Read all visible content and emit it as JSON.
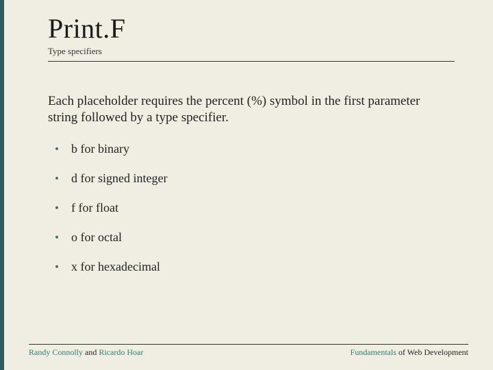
{
  "header": {
    "title": "Print.F",
    "subtitle": "Type specifiers"
  },
  "body": {
    "lead": "Each placeholder requires the percent (%) symbol in the first parameter string followed by a type specifier.",
    "items": [
      "b for binary",
      "d for signed integer",
      "f for float",
      "o for octal",
      "x for hexadecimal"
    ]
  },
  "footer": {
    "left_a": "Randy Connolly",
    "left_mid": " and ",
    "left_b": "Ricardo Hoar",
    "right_a": "Fundamentals",
    "right_b": " of Web Development"
  }
}
